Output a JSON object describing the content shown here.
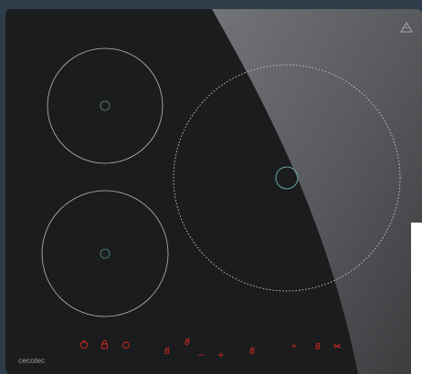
{
  "product": {
    "brand": "cecotec",
    "type": "induction-hob"
  },
  "colors": {
    "background": "#2f3d4a",
    "glass": "#1b1c1e",
    "sheen": "#5a5b5e",
    "zone_outline": "#b8b8b8",
    "control_red": "#e0281e",
    "label": "#9a9a9a"
  },
  "cooking_zones": [
    {
      "id": "top-left",
      "outline": "solid"
    },
    {
      "id": "bottom-left",
      "outline": "solid"
    },
    {
      "id": "right",
      "outline": "dotted"
    }
  ],
  "warning_icon": "hot-surface-warning-triangle",
  "controls": {
    "icons": [
      "power-icon",
      "lock-icon",
      "timer-icon"
    ],
    "digit_glyph": "8",
    "minus_label": "−",
    "plus_label": "+",
    "boost_label": "»",
    "bridge_label": "⋈"
  }
}
